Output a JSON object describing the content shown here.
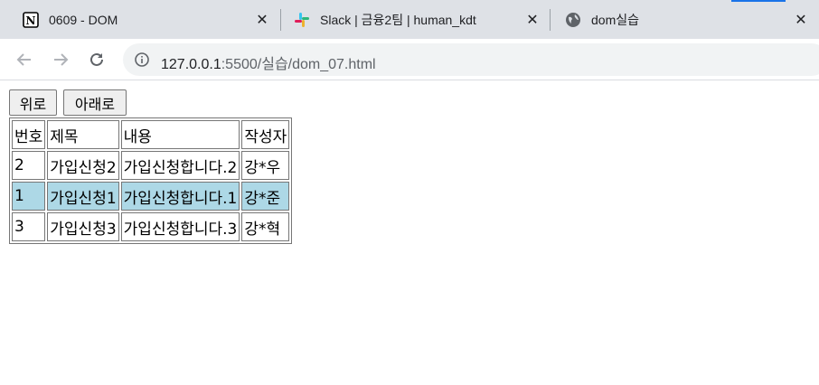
{
  "browser": {
    "tabs": [
      {
        "title": "0609 - DOM",
        "icon": "notion-icon"
      },
      {
        "title": "Slack | 금융2팀 | human_kdt",
        "icon": "slack-icon"
      },
      {
        "title": "dom실습",
        "icon": "globe-icon"
      }
    ],
    "url": {
      "host": "127.0.0.1",
      "rest": ":5500/실습/dom_07.html"
    }
  },
  "page": {
    "buttons": {
      "up": "위로",
      "down": "아래로"
    },
    "table": {
      "headers": [
        "번호",
        "제목",
        "내용",
        "작성자"
      ],
      "rows": [
        {
          "cells": [
            "2",
            "가입신청2",
            "가입신청합니다.2",
            "강*우"
          ],
          "highlighted": false
        },
        {
          "cells": [
            "1",
            "가입신청1",
            "가입신청합니다.1",
            "강*준"
          ],
          "highlighted": true
        },
        {
          "cells": [
            "3",
            "가입신청3",
            "가입신청합니다.3",
            "강*혁"
          ],
          "highlighted": false
        }
      ]
    },
    "highlight_color": "#add8e6"
  }
}
